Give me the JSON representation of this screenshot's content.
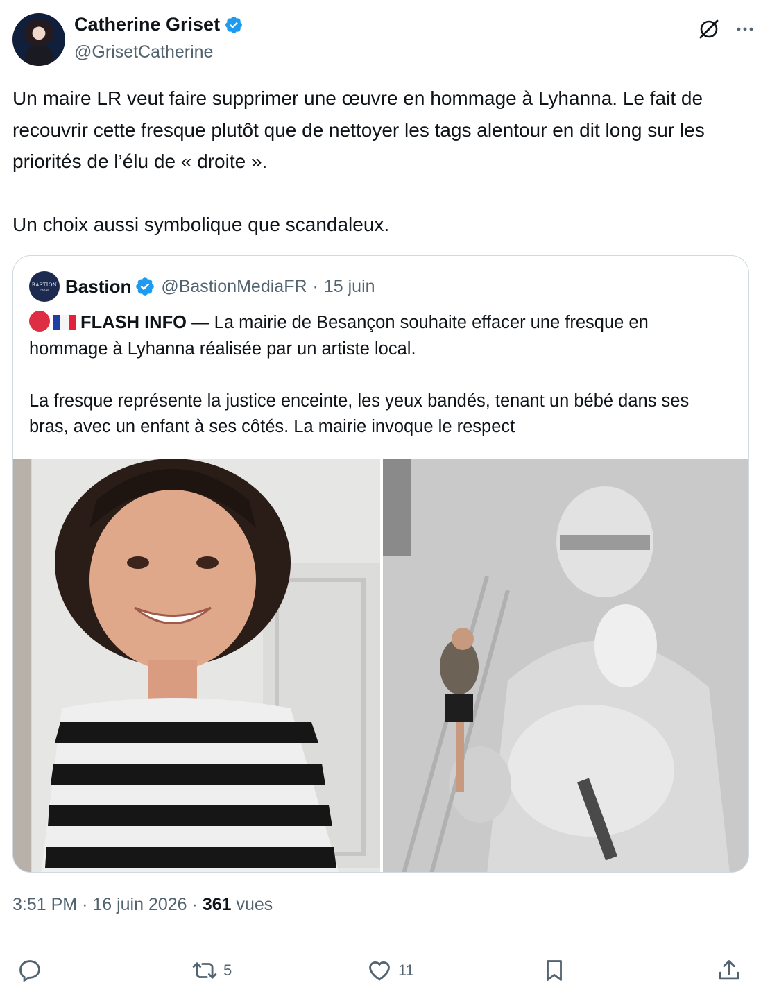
{
  "author": {
    "display_name": "Catherine Griset",
    "handle": "@GrisetCatherine",
    "avatar_icon": "profile-photo"
  },
  "tweet": {
    "text": "Un maire LR veut faire supprimer une œuvre en hommage à Lyhanna. Le fait de recouvrir cette fresque plutôt que de nettoyer les tags alentour en dit long sur les priorités de l’élu de « droite ».\n\nUn choix aussi symbolique que scandaleux."
  },
  "quoted": {
    "avatar_text": "BASTION",
    "avatar_sub": "PRESS",
    "display_name": "Bastion",
    "handle": "@BastionMediaFR",
    "date": "15 juin",
    "separator": "·",
    "flash_label": "FLASH INFO",
    "text_after_flash": " — La mairie de Besançon souhaite effacer une fresque en hommage à Lyhanna réalisée par un artiste local.\n\nLa fresque représente la justice enceinte, les yeux bandés, tenant un bébé dans ses bras, avec un enfant à ses côtés. La mairie invoque le respect",
    "media": [
      "photo of a smiling girl in a striped top",
      "photo of a man on a ladder painting a blindfolded Justice mural"
    ]
  },
  "meta": {
    "time": "3:51 PM",
    "date": "16 juin 2026",
    "views_count": "361",
    "views_label": "vues",
    "separator": "·"
  },
  "actions": {
    "reply_count": "",
    "retweet_count": "5",
    "like_count": "11"
  },
  "colors": {
    "text_primary": "#0f1419",
    "text_secondary": "#536471",
    "verified_blue": "#1d9bf0",
    "border": "#cfd9de"
  }
}
